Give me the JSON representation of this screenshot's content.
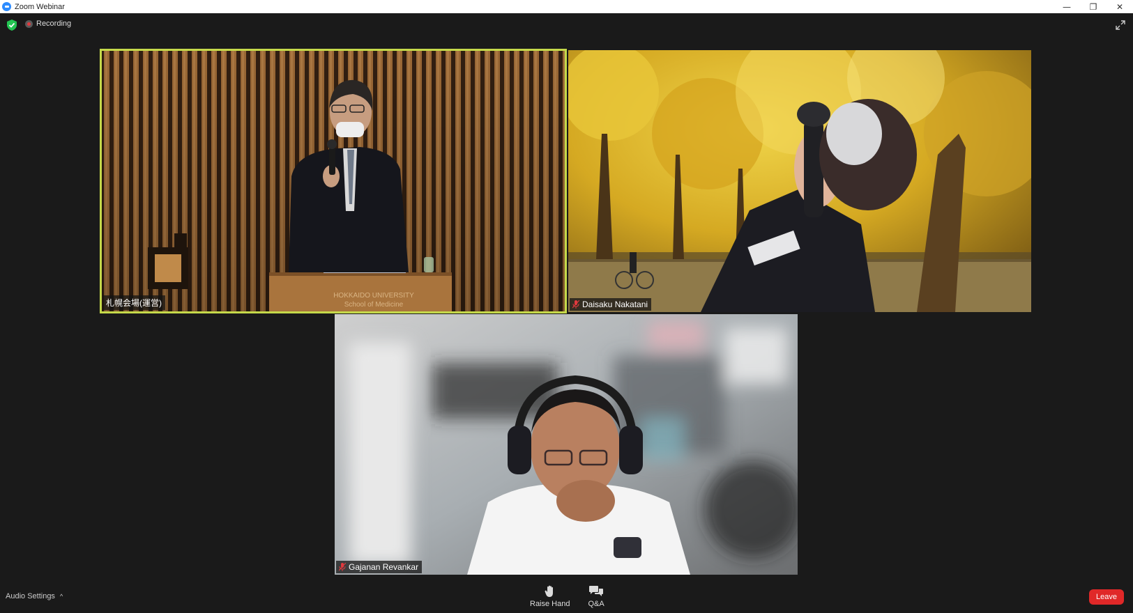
{
  "window": {
    "title": "Zoom Webinar",
    "controls": {
      "minimize": "—",
      "restore": "❐",
      "close": "✕"
    }
  },
  "topbar": {
    "recording_label": "Recording"
  },
  "participants": [
    {
      "name": "札幌会場(運営)",
      "muted": false,
      "active_speaker": true
    },
    {
      "name": "Daisaku Nakatani",
      "muted": true,
      "active_speaker": false
    },
    {
      "name": "Gajanan Revankar",
      "muted": true,
      "active_speaker": false
    }
  ],
  "scene_text": {
    "podium_line1": "HOKKAIDO UNIVERSITY",
    "podium_line2": "School of Medicine"
  },
  "bottombar": {
    "audio_settings_label": "Audio Settings",
    "audio_caret": "^",
    "raise_hand_label": "Raise Hand",
    "qa_label": "Q&A",
    "leave_label": "Leave"
  },
  "colors": {
    "active_speaker_border": "#c5d94a",
    "leave_button": "#e02828",
    "shield": "#23c552",
    "recording_dot": "#e0393e",
    "muted_mic": "#e0393e"
  }
}
